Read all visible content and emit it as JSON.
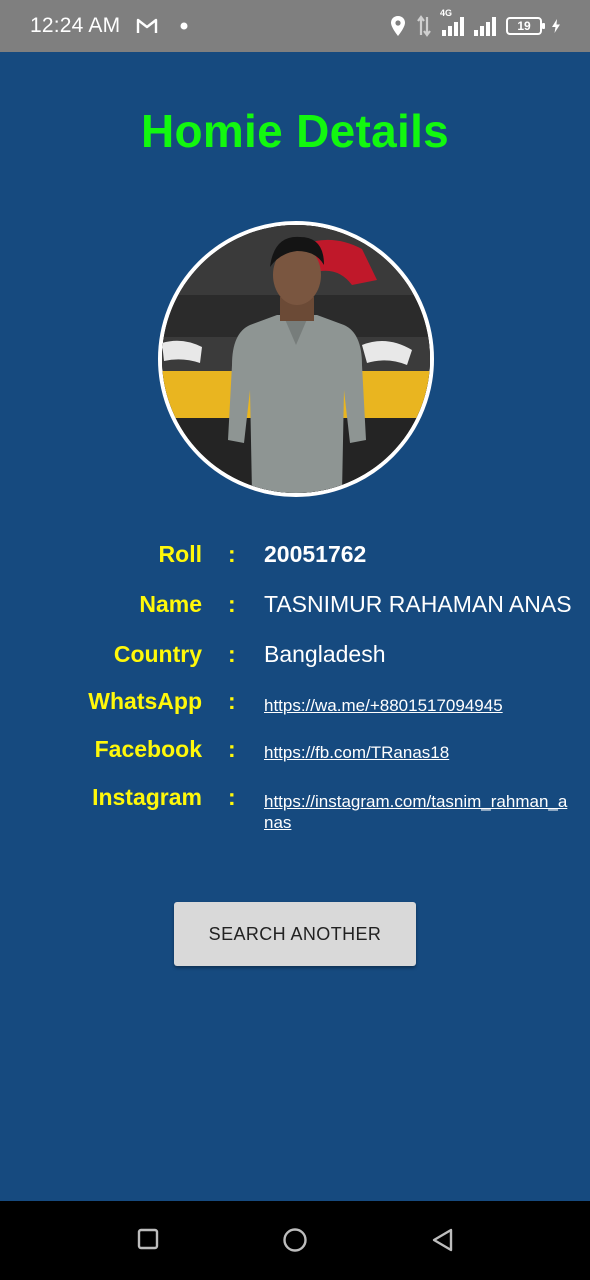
{
  "status_bar": {
    "time": "12:24 AM",
    "network_label": "4G",
    "battery": "19"
  },
  "title": "Homie Details",
  "colors": {
    "background": "#164a7f",
    "title": "#12f80f",
    "label": "#fff80a",
    "value": "#ffffff",
    "button": "#d9d9d9"
  },
  "details": {
    "roll": {
      "label": "Roll",
      "value": "20051762"
    },
    "name": {
      "label": "Name",
      "value": "TASNIMUR RAHAMAN ANAS"
    },
    "country": {
      "label": "Country",
      "value": "Bangladesh"
    },
    "whatsapp": {
      "label": "WhatsApp",
      "value": "https://wa.me/+8801517094945"
    },
    "facebook": {
      "label": "Facebook",
      "value": "https://fb.com/TRanas18"
    },
    "instagram": {
      "label": "Instagram",
      "value": "https://instagram.com/tasnim_rahman_anas"
    },
    "separator": ":"
  },
  "button": {
    "label": "SEARCH ANOTHER"
  },
  "icons": {
    "status": [
      "gmail-icon",
      "dot-icon",
      "location-icon",
      "data-arrows-icon",
      "signal-icon",
      "battery-icon",
      "charging-icon"
    ],
    "nav": [
      "recents-square-icon",
      "home-circle-icon",
      "back-triangle-icon"
    ]
  }
}
